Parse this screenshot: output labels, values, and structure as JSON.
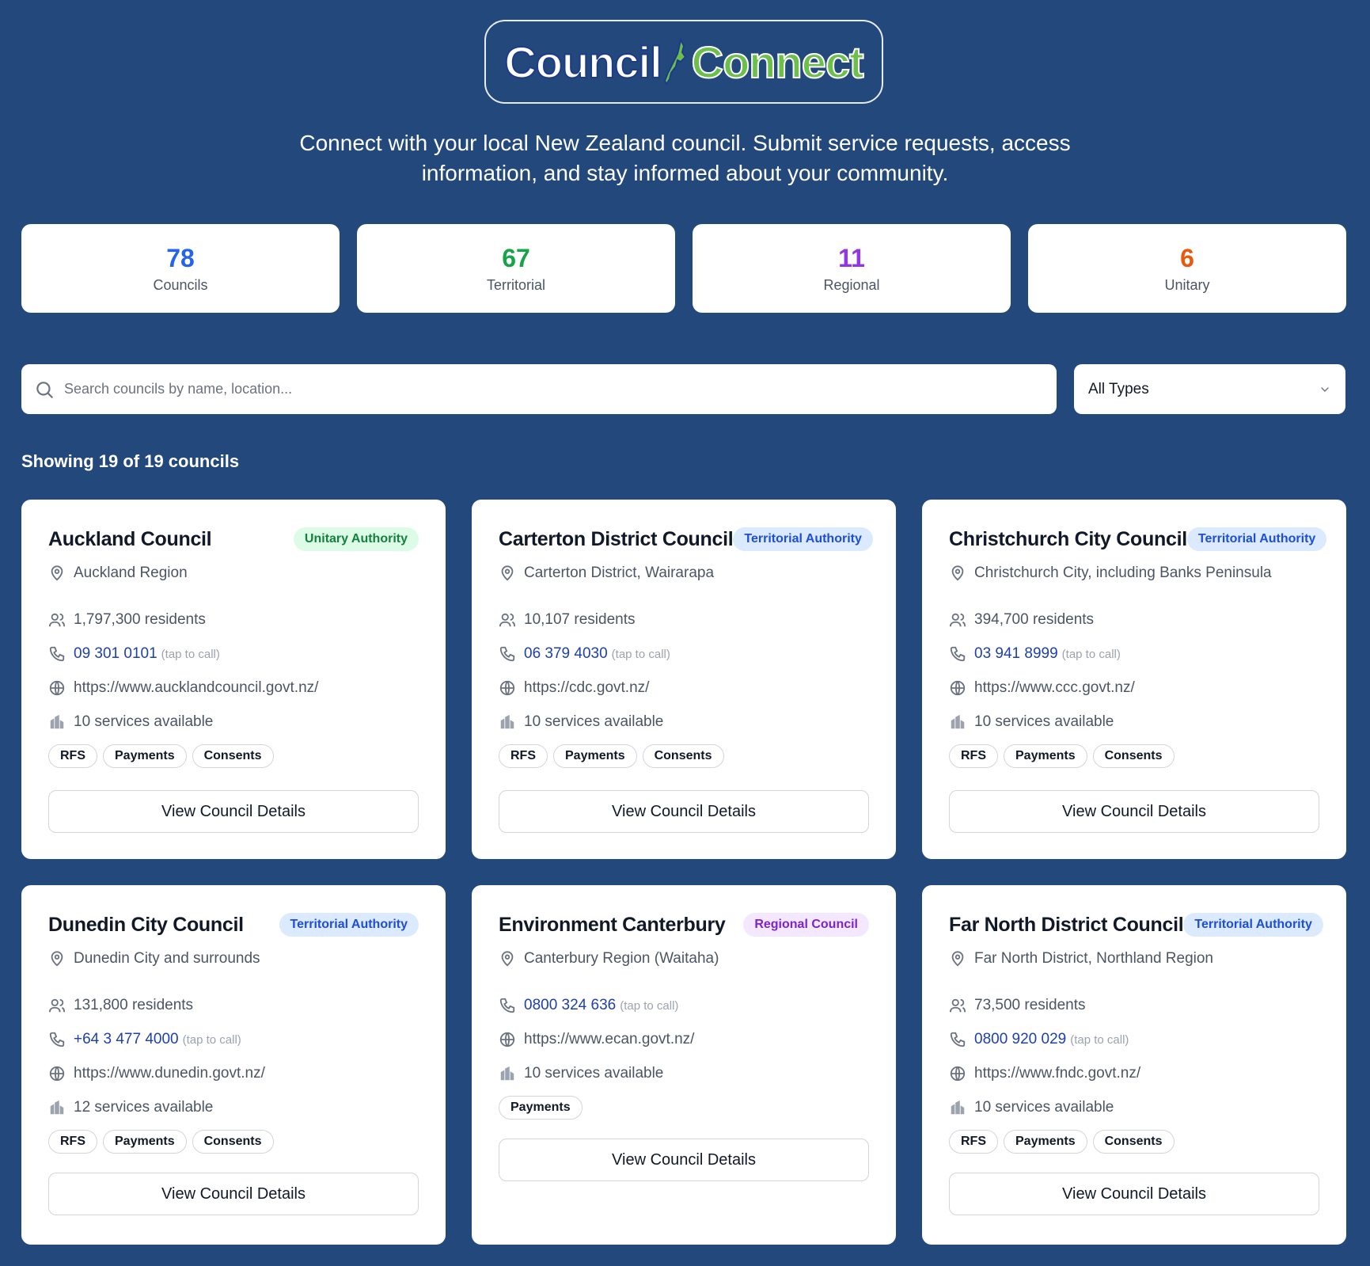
{
  "logo": {
    "part1": "Council",
    "part2": "Connect"
  },
  "tagline": "Connect with your local New Zealand council. Submit service requests, access information, and stay informed about your community.",
  "stats": [
    {
      "value": "78",
      "label": "Councils",
      "color": "#2563eb"
    },
    {
      "value": "67",
      "label": "Territorial",
      "color": "#16a34a"
    },
    {
      "value": "11",
      "label": "Regional",
      "color": "#9333ea"
    },
    {
      "value": "6",
      "label": "Unitary",
      "color": "#ea580c"
    }
  ],
  "search": {
    "placeholder": "Search councils by name, location...",
    "value": ""
  },
  "type_filter": {
    "selected": "All Types"
  },
  "showing": "Showing 19 of 19 councils",
  "tap_hint": "(tap to call)",
  "view_label": "View Council Details",
  "councils": [
    {
      "name": "Auckland Council",
      "type": "Unitary Authority",
      "type_class": "unitary",
      "location": "Auckland Region",
      "residents": "1,797,300 residents",
      "phone": "09 301 0101",
      "website": "https://www.aucklandcouncil.govt.nz/",
      "services": "10 services available",
      "tags": [
        "RFS",
        "Payments",
        "Consents"
      ]
    },
    {
      "name": "Carterton District Council",
      "type": "Territorial Authority",
      "type_class": "territorial",
      "location": "Carterton District, Wairarapa",
      "residents": "10,107 residents",
      "phone": "06 379 4030",
      "website": "https://cdc.govt.nz/",
      "services": "10 services available",
      "tags": [
        "RFS",
        "Payments",
        "Consents"
      ]
    },
    {
      "name": "Christchurch City Council",
      "type": "Territorial Authority",
      "type_class": "territorial",
      "location": "Christchurch City, including Banks Peninsula",
      "residents": "394,700 residents",
      "phone": "03 941 8999",
      "website": "https://www.ccc.govt.nz/",
      "services": "10 services available",
      "tags": [
        "RFS",
        "Payments",
        "Consents"
      ]
    },
    {
      "name": "Dunedin City Council",
      "type": "Territorial Authority",
      "type_class": "territorial",
      "location": "Dunedin City and surrounds",
      "residents": "131,800 residents",
      "phone": "+64 3 477 4000",
      "website": "https://www.dunedin.govt.nz/",
      "services": "12 services available",
      "tags": [
        "RFS",
        "Payments",
        "Consents"
      ]
    },
    {
      "name": "Environment Canterbury",
      "type": "Regional Council",
      "type_class": "regional",
      "location": "Canterbury Region (Waitaha)",
      "residents": "",
      "phone": "0800 324 636",
      "website": "https://www.ecan.govt.nz/",
      "services": "10 services available",
      "tags": [
        "Payments"
      ]
    },
    {
      "name": "Far North District Council",
      "type": "Territorial Authority",
      "type_class": "territorial",
      "location": "Far North District, Northland Region",
      "residents": "73,500 residents",
      "phone": "0800 920 029",
      "website": "https://www.fndc.govt.nz/",
      "services": "10 services available",
      "tags": [
        "RFS",
        "Payments",
        "Consents"
      ]
    }
  ]
}
